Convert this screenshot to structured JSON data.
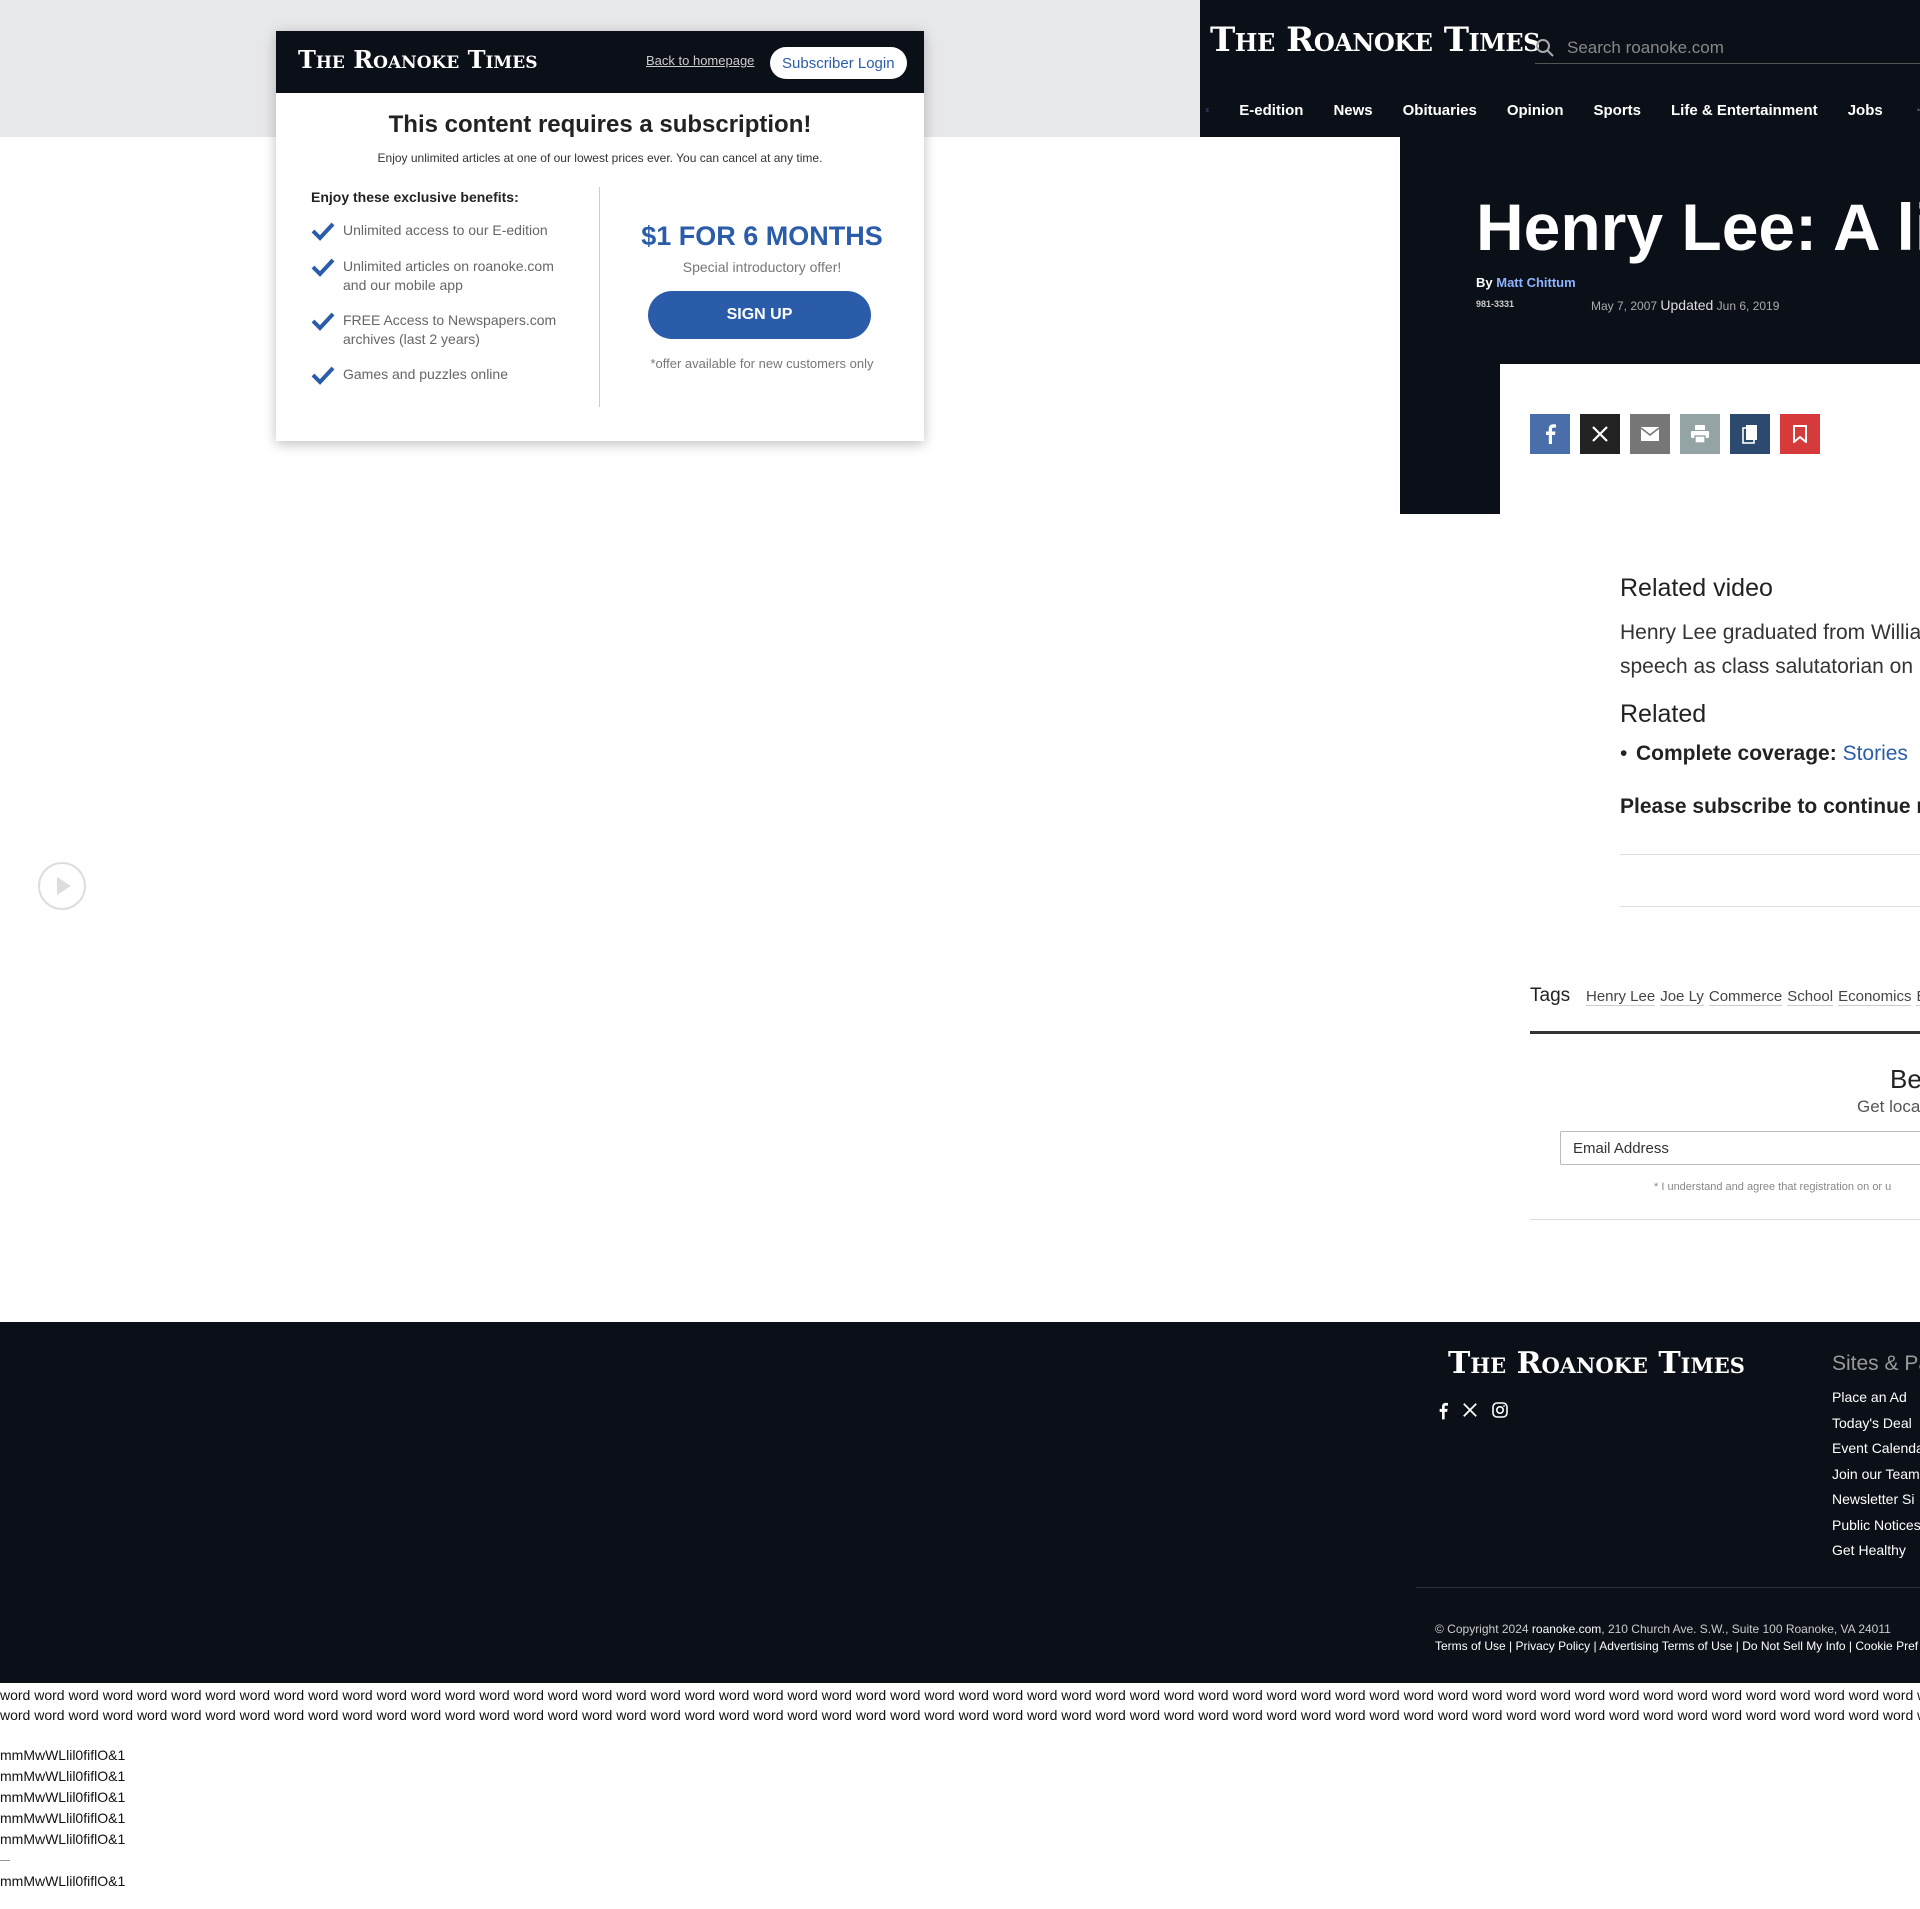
{
  "brand": "The Roanoke Times",
  "colors": {
    "accent": "#2a5caa",
    "dark": "#0b0f17"
  },
  "header": {
    "search_placeholder": "Search roanoke.com",
    "nav": [
      "E-edition",
      "News",
      "Obituaries",
      "Opinion",
      "Sports",
      "Life & Entertainment",
      "Jobs"
    ]
  },
  "modal": {
    "back_link": "Back to homepage",
    "login_label": "Subscriber Login",
    "title": "This content requires a subscription!",
    "subtitle": "Enjoy unlimited articles at one of our lowest prices ever. You can cancel at any time.",
    "benefits_title": "Enjoy these exclusive benefits:",
    "benefits": [
      "Unlimited access to our E-edition",
      "Unlimited articles on roanoke.com and our mobile app",
      "FREE Access to Newspapers.com archives (last 2 years)",
      "Games and puzzles online"
    ],
    "price": "$1 FOR 6 MONTHS",
    "intro": "Special introductory offer!",
    "signup_label": "SIGN UP",
    "note": "*offer available for new customers only"
  },
  "article": {
    "title": "Henry Lee: A lif",
    "by": "By",
    "author": "Matt Chittum",
    "phone": "981-3331",
    "published": "May 7, 2007",
    "updated_label": "Updated",
    "updated": "Jun 6, 2019",
    "related_video_heading": "Related video",
    "related_video_line1": "Henry Lee graduated from Willia",
    "related_video_line2": "speech as class salutatorian on h",
    "related_heading": "Related",
    "coverage_label": "Complete coverage:",
    "coverage_link": "Stories",
    "subscribe_msg": "Please subscribe to continue re"
  },
  "tags": {
    "label": "Tags",
    "items": [
      "Henry Lee",
      "Joe Ly",
      "Commerce",
      "School",
      "Economics",
      "Ed"
    ]
  },
  "newsletter": {
    "title": "Be",
    "subtitle": "Get local",
    "email_placeholder": "Email Address",
    "note": "* I understand and agree that registration on or u"
  },
  "footer": {
    "sites_heading": "Sites & Pa",
    "links": [
      "Place an Ad",
      "Today's Deal",
      "Event Calenda",
      "Join our Team",
      "Newsletter Si",
      "Public Notices",
      "Get Healthy"
    ],
    "copyright_prefix": "© Copyright 2024",
    "copyright_site": "roanoke.com",
    "copyright_addr": ", 210 Church Ave. S.W., Suite 100 Roanoke, VA 24011",
    "legal": "Terms of Use | Privacy Policy | Advertising Terms of Use | Do Not Sell My Info | Cookie Pref"
  },
  "test_text": {
    "word_line": "word word word word word word word word word word word word word word word word word word word word word word word word word word word word word word word word word word word word word word word word word word word word word word word word word word word word word word word word word word word word word word word word word word word word word word word word word word word word word word word word word word word word word word word word word word word word word word word word word word word word word word word word word word word word word word word word word word word word word word word word",
    "glyph": "mmMwWLlil0fiflO&1"
  }
}
